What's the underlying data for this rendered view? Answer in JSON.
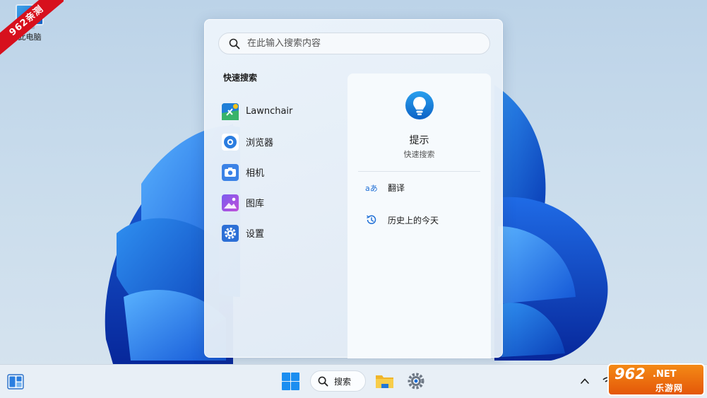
{
  "desktop": {
    "icon_label": "此电脑",
    "watermark_ribbon": "962亲测"
  },
  "search_panel": {
    "placeholder": "在此输入搜索内容",
    "quick_search_title": "快速搜索",
    "apps": [
      {
        "label": "Lawnchair",
        "icon": "lawnchair-icon"
      },
      {
        "label": "浏览器",
        "icon": "browser-icon"
      },
      {
        "label": "相机",
        "icon": "camera-icon"
      },
      {
        "label": "图库",
        "icon": "gallery-icon"
      },
      {
        "label": "设置",
        "icon": "settings-icon"
      }
    ],
    "tip_card": {
      "title": "提示",
      "subtitle": "快速搜索",
      "options": [
        {
          "label": "翻译",
          "icon": "translate-icon"
        },
        {
          "label": "历史上的今天",
          "icon": "history-icon"
        }
      ]
    }
  },
  "taskbar": {
    "search_label": "搜索"
  },
  "watermark": {
    "big": "962",
    "net": ".NET",
    "cn": "乐游网"
  },
  "colors": {
    "accent": "#0a64d2",
    "watermark_red": "#d7101d",
    "watermark_orange": "#ef7413"
  }
}
